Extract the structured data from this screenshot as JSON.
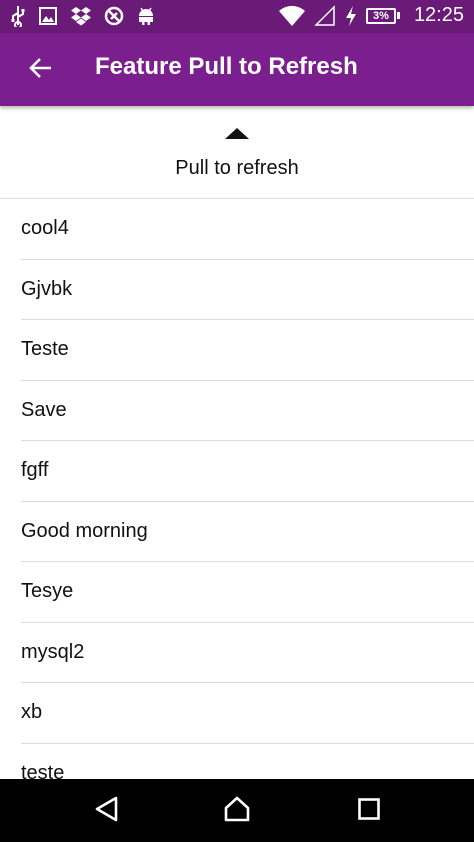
{
  "status_bar": {
    "icons_left": [
      "usb-icon",
      "image-icon",
      "dropbox-icon",
      "no-signal-icon",
      "android-icon"
    ],
    "icons_right": [
      "wifi-icon",
      "cell-signal-icon",
      "charging-icon",
      "battery-icon"
    ],
    "battery_level": "3%",
    "time": "12:25",
    "color": "#6a1b78"
  },
  "app_bar": {
    "title": "Feature Pull to Refresh",
    "back_icon": "arrow-back-icon",
    "color": "#7b1f8e"
  },
  "pull_header": {
    "arrow_icon": "arrow-up-icon",
    "text": "Pull to refresh"
  },
  "list": {
    "items": [
      {
        "label": "cool4"
      },
      {
        "label": "Gjvbk"
      },
      {
        "label": "Teste"
      },
      {
        "label": "Save"
      },
      {
        "label": "fgff"
      },
      {
        "label": "Good morning"
      },
      {
        "label": "Tesye"
      },
      {
        "label": "mysql2"
      },
      {
        "label": "xb"
      },
      {
        "label": "teste"
      }
    ]
  },
  "nav_bar": {
    "buttons": [
      "back-triangle-icon",
      "home-icon",
      "recents-icon"
    ]
  }
}
